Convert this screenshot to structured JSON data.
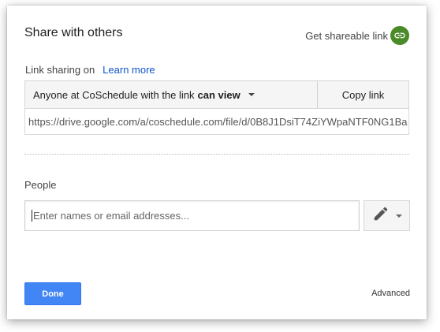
{
  "dialog": {
    "title": "Share with others",
    "shareable_link_label": "Get shareable link",
    "shareable_link_icon": "link-icon",
    "accent_color": "#4a8a28"
  },
  "link_sharing": {
    "status": "Link sharing on",
    "learn_more": "Learn more",
    "permission_prefix": "Anyone at CoSchedule with the link",
    "permission_level": "can view",
    "copy_link": "Copy link",
    "url": "https://drive.google.com/a/coschedule.com/file/d/0B8J1DsiT74ZiYWpaNTF0NG1Ba"
  },
  "people": {
    "label": "People",
    "placeholder": "Enter names or email addresses...",
    "permission_icon": "pencil-icon"
  },
  "footer": {
    "done": "Done",
    "done_color": "#4285f4",
    "advanced": "Advanced"
  }
}
